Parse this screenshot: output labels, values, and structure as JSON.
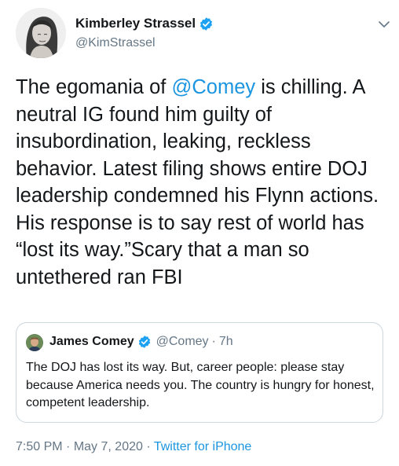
{
  "author": {
    "name": "Kimberley Strassel",
    "handle": "@KimStrassel",
    "verified": true
  },
  "tweet": {
    "text_before_mention": "The egomania of ",
    "mention": "@Comey",
    "text_after_mention": " is chilling. A neutral IG found him guilty of insubordination, leaking, reckless behavior. Latest filing shows entire DOJ leadership condemned his Flynn actions. His response is to say rest of world has “lost its way.”Scary that a man so untethered ran FBI"
  },
  "quoted_tweet": {
    "name": "James Comey",
    "handle": "@Comey",
    "separator": "·",
    "time": "7h",
    "text": "The DOJ has lost its way. But, career people: please stay because America needs you. The country is hungry for honest, competent leadership."
  },
  "meta": {
    "time": "7:50 PM",
    "separator": "·",
    "date": "May 7, 2020",
    "source": "Twitter for iPhone"
  },
  "colors": {
    "link": "#1b95e0",
    "secondary_text": "#657786",
    "verified_badge": "#1da1f2",
    "border": "#ccd6dd"
  },
  "icons": {
    "verified": "verified-badge-icon",
    "menu": "chevron-down-icon"
  }
}
